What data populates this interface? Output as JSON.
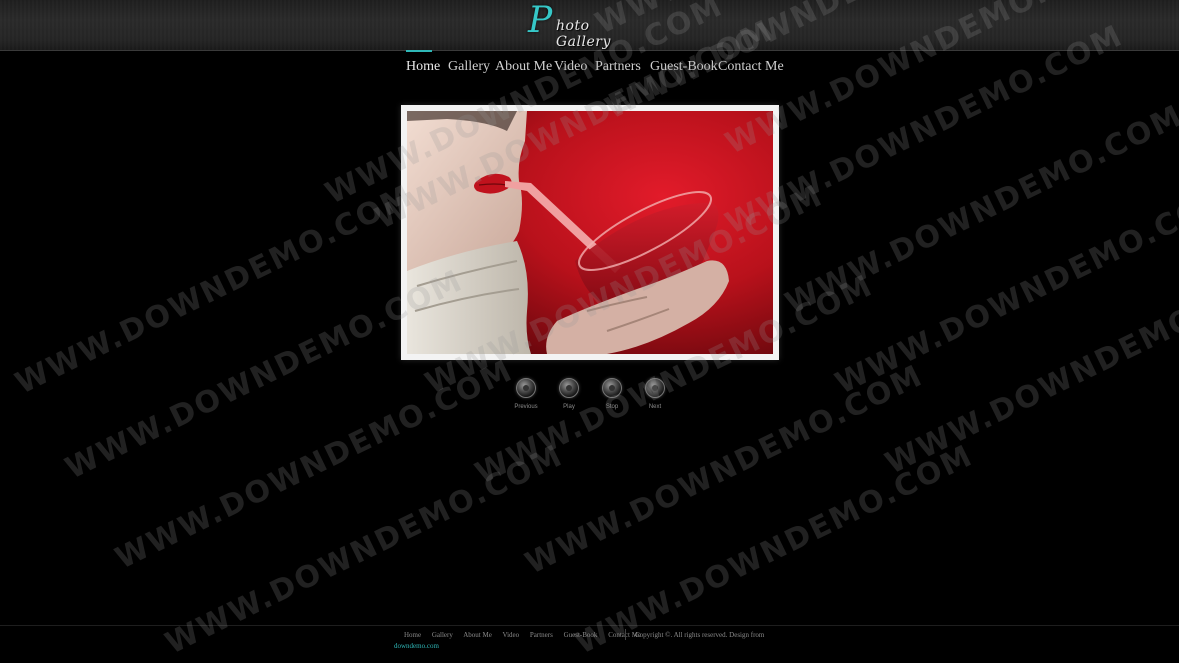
{
  "header": {
    "logo_initial": "P",
    "logo_text": "hoto Gallery"
  },
  "nav": {
    "active": "Home",
    "items": [
      "Home",
      "Gallery",
      "About Me",
      "Video",
      "Partners",
      "Guest-Book",
      "Contact Me"
    ]
  },
  "gallery": {
    "photo_alt": "woman sipping red drink through a straw"
  },
  "controls": {
    "previous": "Previous",
    "play": "Play",
    "stop": "Stop",
    "next": "Next"
  },
  "footer": {
    "links": [
      "Home",
      "Gallery",
      "About Me",
      "Video",
      "Partners",
      "Guest-Book",
      "Contact Me"
    ],
    "copyright": "Copyright ©. All rights reserved. Design from",
    "domain": "downdemo.com"
  },
  "watermark": {
    "text": "WWW.DOWNDEMO.COM"
  },
  "colors": {
    "accent": "#2fb8b8",
    "background": "#000000",
    "frame": "#f3f3f3",
    "photo_red": "#c8141f"
  }
}
